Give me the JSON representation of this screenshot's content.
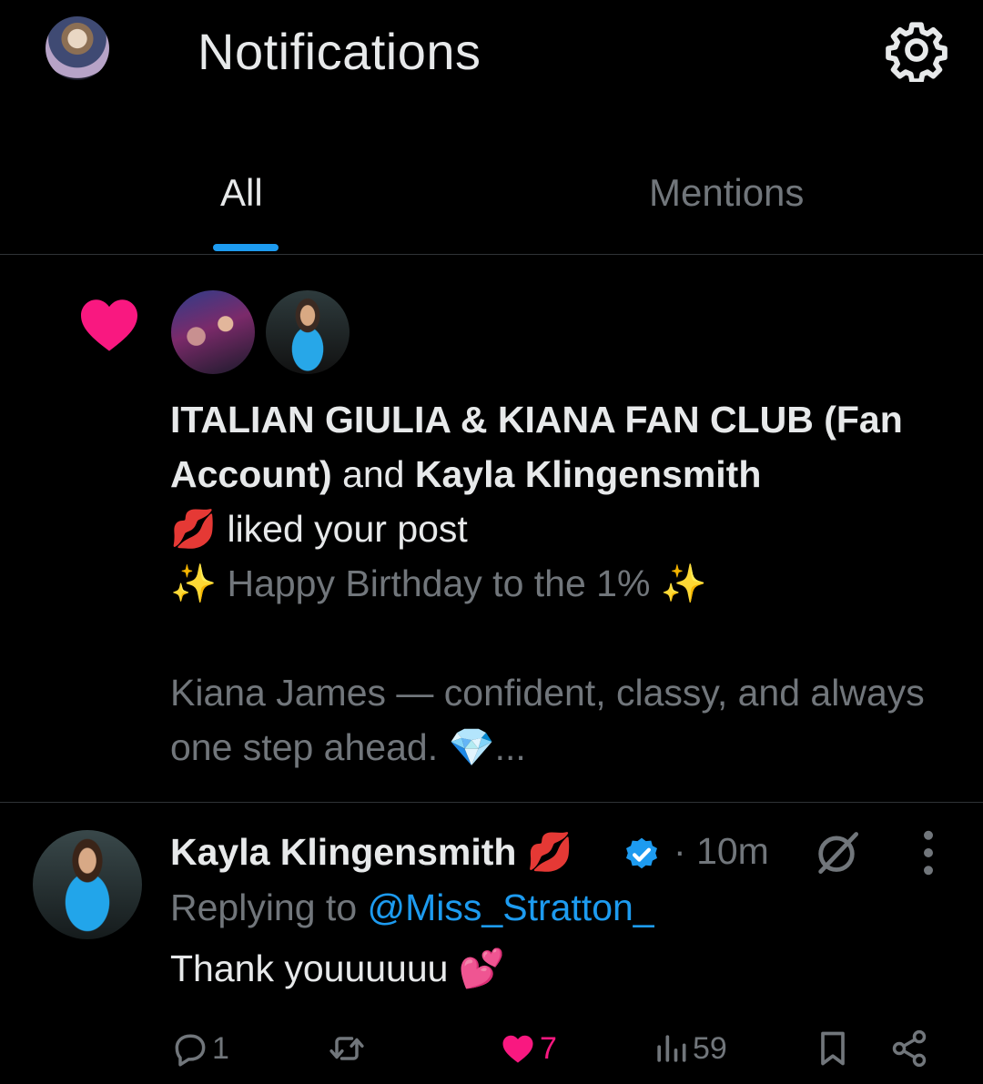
{
  "header": {
    "title": "Notifications",
    "settings_icon": "gear-icon"
  },
  "tabs": [
    {
      "label": "All",
      "active": true
    },
    {
      "label": "Mentions",
      "active": false
    }
  ],
  "notification": {
    "type_icon": "heart-icon",
    "user1": "ITALIAN GIULIA & KIANA FAN CLUB (Fan Account)",
    "conjunction": "and",
    "user2": "Kayla Klingensmith",
    "user2_emoji": "💋",
    "action": "liked your post",
    "preview_line1_sparkle_left": "✨",
    "preview_line1": "Happy Birthday to the 1%",
    "preview_line1_sparkle_right": "✨",
    "preview_line2": "Kiana James — confident, classy, and always one step ahead.",
    "preview_gem": "💎",
    "preview_ellipsis": "..."
  },
  "reply": {
    "name": "Kayla Klingensmith",
    "name_emoji": "💋",
    "separator": "·",
    "time": "10m",
    "replying_prefix": "Replying to",
    "replying_handle": "@Miss_Stratton_",
    "text": "Thank youuuuuu",
    "text_emoji": "💕",
    "counts": {
      "replies": "1",
      "reposts": "",
      "likes": "7",
      "views": "59"
    }
  },
  "colors": {
    "accent": "#1d9bf0",
    "like": "#f91880",
    "muted": "#71767b",
    "text": "#e7e9ea",
    "divider": "#2f3336"
  }
}
